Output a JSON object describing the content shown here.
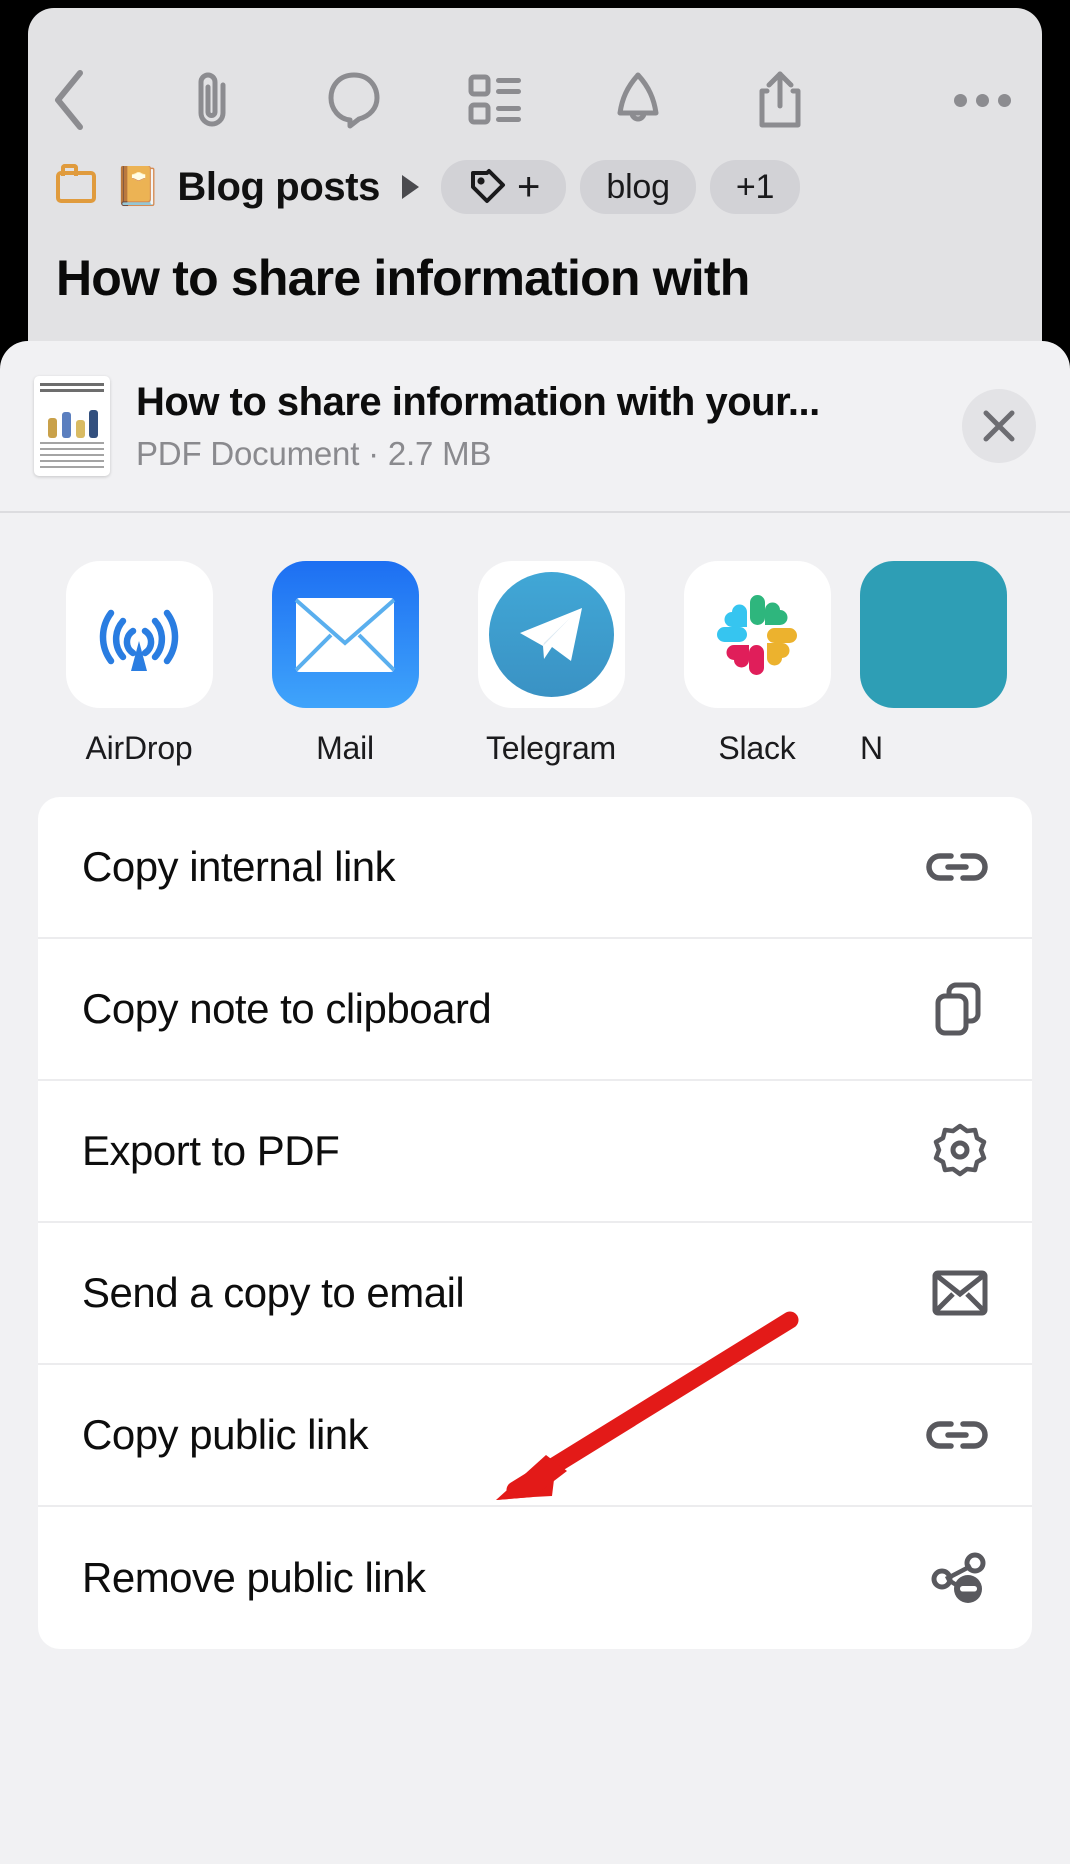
{
  "app": {
    "toolbar": {
      "icons": [
        {
          "name": "back-chevron-icon",
          "label": "Back"
        },
        {
          "name": "paperclip-icon",
          "label": "Attachments"
        },
        {
          "name": "comment-bubble-icon",
          "label": "Comments"
        },
        {
          "name": "task-list-icon",
          "label": "Tasks"
        },
        {
          "name": "bell-icon",
          "label": "Reminders"
        },
        {
          "name": "share-icon",
          "label": "Share"
        },
        {
          "name": "more-dots-icon",
          "label": "More"
        }
      ]
    },
    "breadcrumb": {
      "folder_icon": "folder-icon",
      "book_emoji": "📔",
      "name": "Blog posts",
      "arrow": "▶",
      "chips": [
        {
          "name": "tag-add-chip",
          "icon": "tag-icon",
          "text": "+"
        },
        {
          "name": "tag-chip-blog",
          "text": "blog"
        },
        {
          "name": "tag-chip-overflow",
          "text": "+1"
        }
      ]
    },
    "note_title": "How to share information with"
  },
  "share_sheet": {
    "file": {
      "title": "How to share information with your...",
      "subtitle": "PDF Document · 2.7 MB",
      "thumbnail_name": "pdf-thumbnail",
      "close_icon": "close-icon"
    },
    "apps": [
      {
        "name": "airdrop",
        "label": "AirDrop",
        "icon": "airdrop-icon"
      },
      {
        "name": "mail",
        "label": "Mail",
        "icon": "mail-icon"
      },
      {
        "name": "telegram",
        "label": "Telegram",
        "icon": "telegram-icon"
      },
      {
        "name": "slack",
        "label": "Slack",
        "icon": "slack-icon"
      },
      {
        "name": "partial",
        "label": "N",
        "icon": "partial-app-icon"
      }
    ],
    "actions": [
      {
        "label": "Copy internal link",
        "icon": "link-icon"
      },
      {
        "label": "Copy note to clipboard",
        "icon": "copy-icon"
      },
      {
        "label": "Export to PDF",
        "icon": "gear-icon"
      },
      {
        "label": "Send a copy to email",
        "icon": "envelope-icon"
      },
      {
        "label": "Copy public link",
        "icon": "link-icon"
      },
      {
        "label": "Remove public link",
        "icon": "share-minus-icon"
      }
    ]
  },
  "annotation": {
    "arrow_color": "#e31a18",
    "points_to": "Remove public link"
  },
  "colors": {
    "sheet_bg": "#f1f1f3",
    "card_bg": "#ffffff",
    "note_bg": "#e2e2e4",
    "chip_bg": "#d2d2d6",
    "accent_folder": "#e09b3d",
    "icon_gray": "#59595e",
    "subtext_gray": "#8a8a8e"
  }
}
